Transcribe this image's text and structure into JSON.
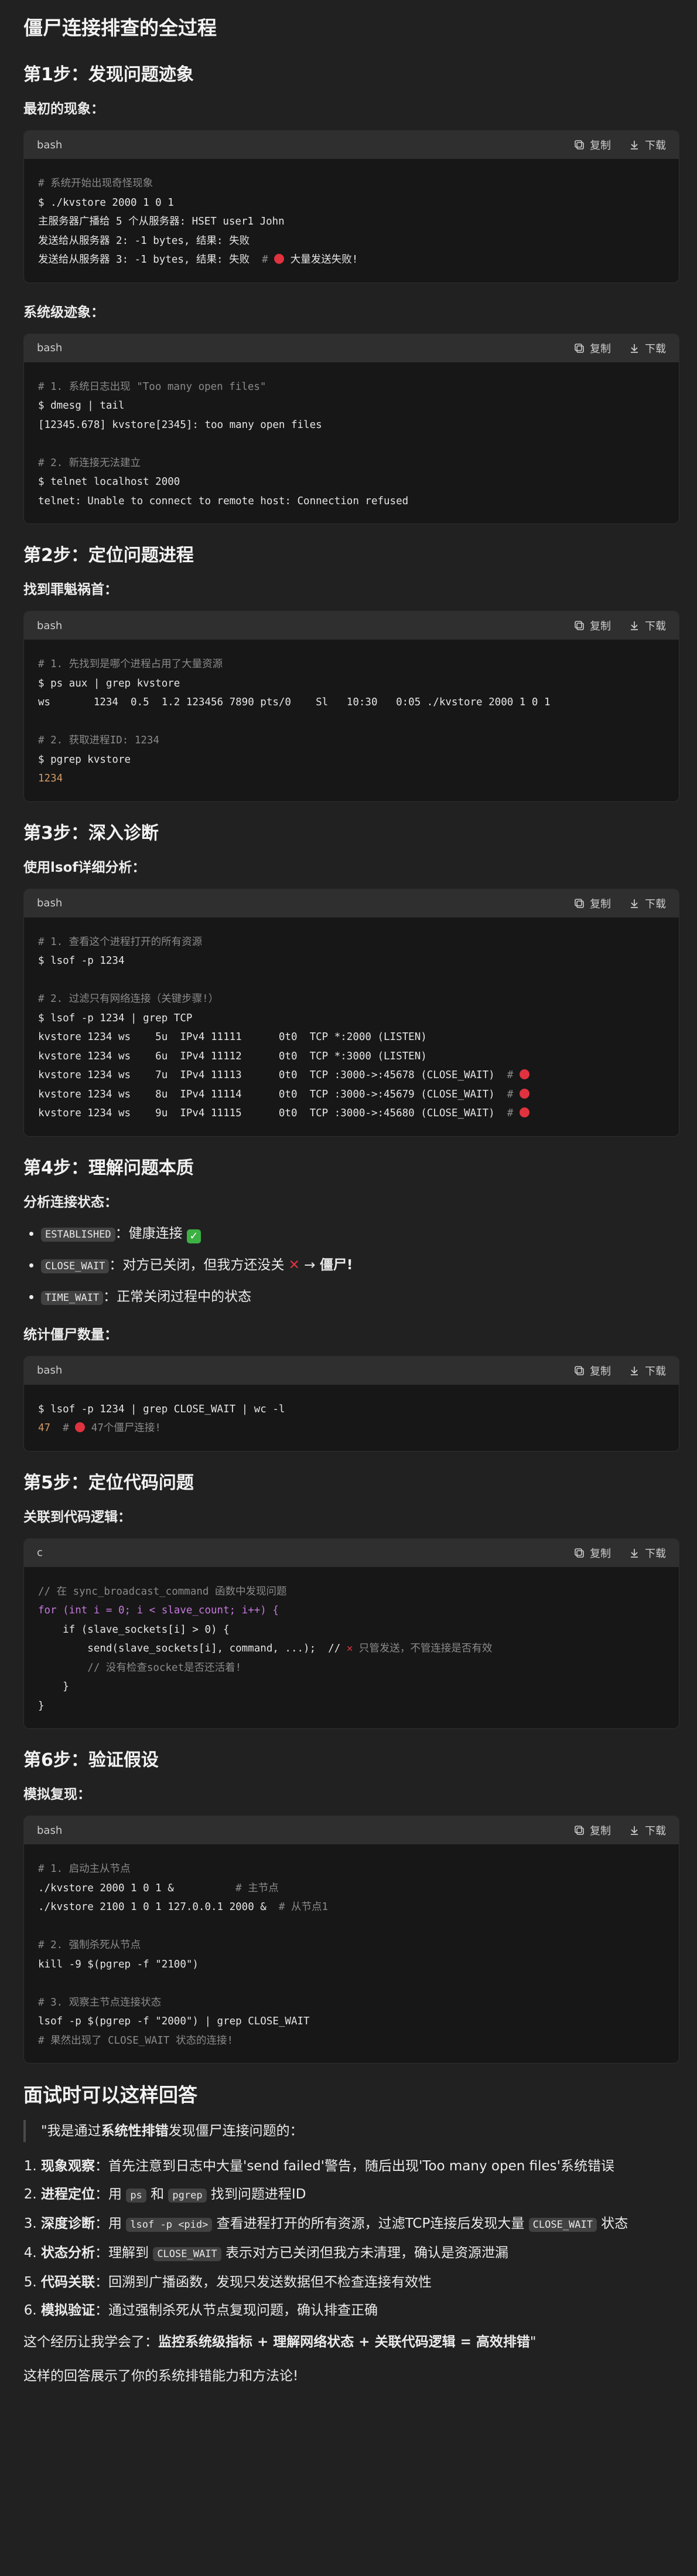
{
  "title": "僵尸连接排查的全过程",
  "copy_label": "复制",
  "download_label": "下载",
  "step1": {
    "heading": "第1步：发现问题迹象",
    "initial_label": "最初的现象：",
    "block1_lang": "bash",
    "block1": [
      "# 系统开始出现奇怪现象",
      "$ ./kvstore 2000 1 0 1",
      "主服务器广播给 5 个从服务器: HSET user1 John",
      "发送给从服务器 2: -1 bytes, 结果: 失败",
      "发送给从服务器 3: -1 bytes, 结果: 失败",
      "大量发送失败!"
    ],
    "system_label": "系统级迹象：",
    "block2_lang": "bash",
    "block2": [
      "# 1. 系统日志出现 \"Too many open files\"",
      "$ dmesg | tail",
      "[12345.678] kvstore[2345]: too many open files",
      "# 2. 新连接无法建立",
      "$ telnet localhost 2000",
      "telnet: Unable to connect to remote host: Connection refused"
    ]
  },
  "step2": {
    "heading": "第2步：定位问题进程",
    "label": "找到罪魁祸首：",
    "block_lang": "bash",
    "block": [
      "# 1. 先找到是哪个进程占用了大量资源",
      "$ ps aux | grep kvstore",
      "ws       1234  0.5  1.2 123456 7890 pts/0    Sl   10:30   0:05 ./kvstore 2000 1 0 1",
      "# 2. 获取进程ID: 1234",
      "$ pgrep kvstore",
      "1234"
    ]
  },
  "step3": {
    "heading": "第3步：深入诊断",
    "label": "使用lsof详细分析：",
    "block_lang": "bash",
    "block": [
      "# 1. 查看这个进程打开的所有资源",
      "$ lsof -p 1234",
      "# 2. 过滤只有网络连接（关键步骤!）",
      "$ lsof -p 1234 | grep TCP",
      "kvstore 1234 ws    5u  IPv4 11111      0t0  TCP *:2000 (LISTEN)",
      "kvstore 1234 ws    6u  IPv4 11112      0t0  TCP *:3000 (LISTEN)",
      "kvstore 1234 ws    7u  IPv4 11113      0t0  TCP :3000->:45678 (CLOSE_WAIT)",
      "kvstore 1234 ws    8u  IPv4 11114      0t0  TCP :3000->:45679 (CLOSE_WAIT)",
      "kvstore 1234 ws    9u  IPv4 11115      0t0  TCP :3000->:45680 (CLOSE_WAIT)"
    ]
  },
  "step4": {
    "heading": "第4步：理解问题本质",
    "label": "分析连接状态：",
    "states": [
      {
        "code": "ESTABLISHED",
        "desc": "：健康连接"
      },
      {
        "code": "CLOSE_WAIT",
        "desc": "：对方已关闭，但我方还没关",
        "tail": "僵尸!"
      },
      {
        "code": "TIME_WAIT",
        "desc": "：正常关闭过程中的状态"
      }
    ],
    "count_label": "统计僵尸数量：",
    "block_lang": "bash",
    "block": [
      "$ lsof -p 1234 | grep CLOSE_WAIT | wc -l",
      "47",
      "47个僵尸连接!"
    ]
  },
  "step5": {
    "heading": "第5步：定位代码问题",
    "label": "关联到代码逻辑：",
    "block_lang": "c",
    "block": [
      "// 在 sync_broadcast_command 函数中发现问题",
      "for (int i = 0; i < slave_count; i++) {",
      "    if (slave_sockets[i] > 0) {",
      "        send(slave_sockets[i], command, ...);  //",
      "只管发送，不管连接是否有效",
      "        // 没有检查socket是否还活着!",
      "    }",
      "}"
    ]
  },
  "step6": {
    "heading": "第6步：验证假设",
    "label": "模拟复现：",
    "block_lang": "bash",
    "block": [
      "# 1. 启动主从节点",
      "./kvstore 2000 1 0 1 &",
      "# 主节点",
      "./kvstore 2100 1 0 1 127.0.0.1 2000 &",
      "# 从节点1",
      "# 2. 强制杀死从节点",
      "kill -9 $(pgrep -f \"2100\")",
      "# 3. 观察主节点连接状态",
      "lsof -p $(pgrep -f \"2000\") | grep CLOSE_WAIT",
      "# 果然出现了 CLOSE_WAIT 状态的连接!"
    ]
  },
  "interview": {
    "heading": "面试时可以这样回答",
    "quote_pre": "\"我是通过",
    "quote_bold": "系统性排错",
    "quote_post": "发现僵尸连接问题的：",
    "items": [
      {
        "bold": "现象观察",
        "text": "：首先注意到日志中大量'send failed'警告，随后出现'Too many open files'系统错误"
      },
      {
        "bold": "进程定位",
        "text_a": "：用 ",
        "code_a": "ps",
        "text_b": " 和 ",
        "code_b": "pgrep",
        "text_c": " 找到问题进程ID"
      },
      {
        "bold": "深度诊断",
        "text_a": "：用 ",
        "code_a": "lsof -p <pid>",
        "text_b": " 查看进程打开的所有资源，过滤TCP连接后发现大量 ",
        "code_b": "CLOSE_WAIT",
        "text_c": " 状态"
      },
      {
        "bold": "状态分析",
        "text_a": "：理解到 ",
        "code_a": "CLOSE_WAIT",
        "text_b": " 表示对方已关闭但我方未清理，确认是资源泄漏"
      },
      {
        "bold": "代码关联",
        "text": "：回溯到广播函数，发现只发送数据但不检查连接有效性"
      },
      {
        "bold": "模拟验证",
        "text": "：通过强制杀死从节点复现问题，确认排查正确"
      }
    ],
    "summary_pre": "这个经历让我学会了：",
    "summary_bold": "监控系统级指标 + 理解网络状态 + 关联代码逻辑 = 高效排错",
    "summary_post": "\"",
    "last": "这样的回答展示了你的系统排错能力和方法论!"
  }
}
